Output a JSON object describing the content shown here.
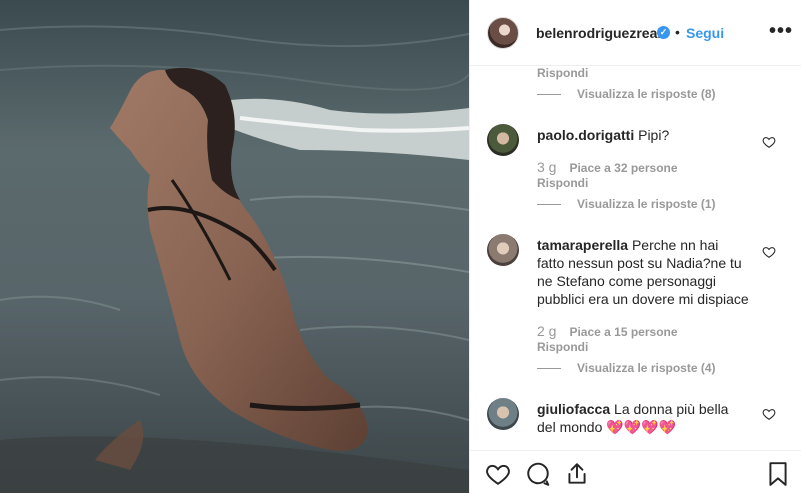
{
  "post": {
    "username": "belenrodriguezreal",
    "verified_mark": "✓",
    "separator": "•",
    "follow_label": "Segui",
    "more_label": "•••"
  },
  "comments": {
    "top_reply_label": "Rispondi",
    "top_view_replies": "Visualizza le risposte (8)",
    "items": [
      {
        "username": "paolo.dorigatti",
        "text": "Pipi?",
        "age": "3 g",
        "likes": "Piace a 32 persone",
        "reply_label": "Rispondi",
        "view_replies": "Visualizza le risposte (1)"
      },
      {
        "username": "tamaraperella",
        "text": "Perche nn hai fatto nessun post su Nadia?ne tu ne Stefano come personaggi pubblici era un dovere mi dispiace",
        "age": "2 g",
        "likes": "Piace a 15 persone",
        "reply_label": "Rispondi",
        "view_replies": "Visualizza le risposte (4)"
      },
      {
        "username": "giuliofacca",
        "text": "La donna più bella del mondo 💖💖💖💖"
      }
    ]
  },
  "icons": {
    "like": "heart-icon",
    "comment": "comment-icon",
    "share": "share-icon",
    "save": "bookmark-icon",
    "verified": "verified-badge-icon",
    "more": "more-options-icon"
  },
  "colors": {
    "link_blue": "#3897f0",
    "muted_gray": "#999999",
    "text": "#262626",
    "border": "#efefef"
  }
}
